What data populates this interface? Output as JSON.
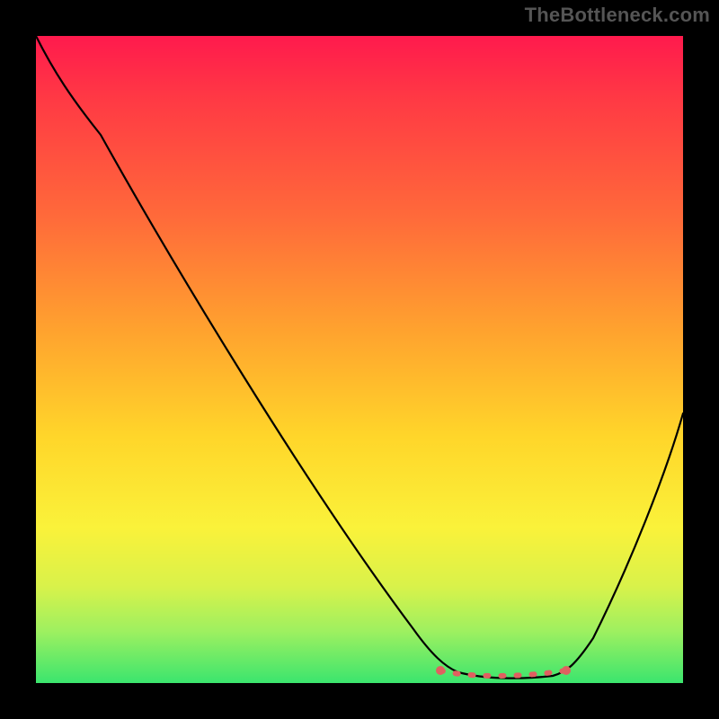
{
  "watermark": "TheBottleneck.com",
  "colors": {
    "page_bg": "#000000",
    "gradient_top": "#ff1a4d",
    "gradient_bottom": "#3be56e",
    "curve": "#000000",
    "highlight": "#e06060"
  },
  "chart_data": {
    "type": "line",
    "title": "",
    "xlabel": "",
    "ylabel": "",
    "xlim": [
      0,
      100
    ],
    "ylim": [
      0,
      100
    ],
    "grid": false,
    "note": "Axes are implied (no tick labels shown). Values below are estimated from the rendered curve: x is horizontal position (0 left, 100 right), y is vertical position (0 bottom, 100 top).",
    "series": [
      {
        "name": "bottleneck-curve",
        "x": [
          0,
          5,
          10,
          15,
          20,
          25,
          30,
          35,
          40,
          45,
          50,
          55,
          60,
          62,
          65,
          70,
          75,
          80,
          82,
          85,
          90,
          95,
          100
        ],
        "y": [
          100,
          96,
          90,
          83,
          76,
          68,
          60,
          52,
          43,
          34,
          25,
          16,
          7,
          4,
          2,
          1,
          1,
          2,
          3,
          8,
          18,
          30,
          42
        ]
      }
    ],
    "highlight_range": {
      "description": "dotted muted-red segment marking the flat minimum of the curve",
      "x_start": 62,
      "x_end": 82,
      "y": 2
    }
  }
}
